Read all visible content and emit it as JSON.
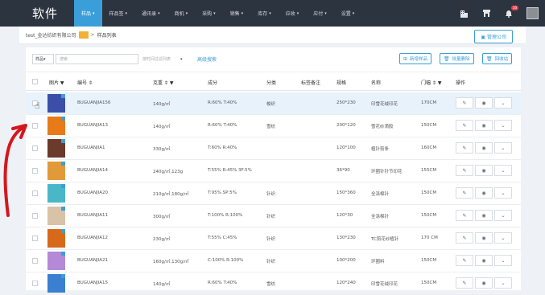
{
  "app": {
    "brand": "软件"
  },
  "nav": [
    {
      "label": "样品",
      "active": true
    },
    {
      "label": "样品签",
      "active": false
    },
    {
      "label": "通讯录",
      "active": false
    },
    {
      "label": "商机",
      "active": false
    },
    {
      "label": "采购",
      "active": false
    },
    {
      "label": "销售",
      "active": false
    },
    {
      "label": "库存",
      "active": false
    },
    {
      "label": "应收",
      "active": false
    },
    {
      "label": "应付",
      "active": false
    },
    {
      "label": "设置",
      "active": false
    }
  ],
  "top": {
    "notify_count": "10"
  },
  "breadcrumb": {
    "company": "test_金达纺织有限公司",
    "sep": ">",
    "page": "样品列表"
  },
  "manage_company": "管理公司",
  "toolbar": {
    "type_select": "样品",
    "search_placeholder": "搜索",
    "filter_placeholder": "按时间过滤列表",
    "advanced": "高级搜索",
    "add": "新增样品",
    "batch_delete": "批量删除",
    "recycle": "回收站"
  },
  "columns": [
    "图片",
    "编号",
    "克重",
    "成分",
    "分类",
    "标签备注",
    "规格",
    "名称",
    "门幅",
    "操作"
  ],
  "rows": [
    {
      "code": "BUGUANJIA156",
      "weight": "140g/㎡",
      "comp": "R:60% T:40%",
      "cat": "梭织",
      "spec": "250*230",
      "name": "印雪花绒印花",
      "width": "170CM",
      "color": "#3b4fa8",
      "hl": true
    },
    {
      "code": "BUGUANJIA13",
      "weight": "140g/㎡",
      "comp": "R:60% T:40%",
      "cat": "雪纺",
      "spec": "200*120",
      "name": "雪花纱滴胶",
      "width": "150CM",
      "color": "#e87a18",
      "hl": false
    },
    {
      "code": "BUGUANJIA1",
      "weight": "330g/㎡",
      "comp": "T:60% R:40%",
      "cat": "",
      "spec": "120*100",
      "name": "植针剪条",
      "width": "160CM",
      "color": "#6b3a2a",
      "hl": false
    },
    {
      "code": "BUGUANJIA14",
      "weight": "240g/㎡,123g",
      "comp": "T:55% R:45% 3F:5%",
      "cat": "",
      "spec": "36*90",
      "name": "环圈针针节印花",
      "width": "155CM",
      "color": "#e09a3a",
      "hl": false
    },
    {
      "code": "BUGUANJIA20",
      "weight": "210g/㎡,180g/㎡",
      "comp": "T:95% SP:5%",
      "cat": "针织",
      "spec": "150*360",
      "name": "全涤棉针",
      "width": "150CM",
      "color": "#4ab7c9",
      "hl": false
    },
    {
      "code": "BUGUANJIA11",
      "weight": "300g/㎡",
      "comp": "T:100% R:100%",
      "cat": "针织",
      "spec": "120*30",
      "name": "全涤棉针",
      "width": "150CM",
      "color": "#d8c3a8",
      "hl": false
    },
    {
      "code": "BUGUANJIA12",
      "weight": "230g/㎡",
      "comp": "T:55% C:45%",
      "cat": "针织",
      "spec": "130*230",
      "name": "TC剪花纱植针",
      "width": "170 CM",
      "color": "#d66a1a",
      "hl": false
    },
    {
      "code": "BUGUANJIA21",
      "weight": "160g/㎡,130g/㎡",
      "comp": "C:100% R:100%",
      "cat": "针织",
      "spec": "100*200",
      "name": "环圈料",
      "width": "150CM",
      "color": "#b48ad8",
      "hl": false
    },
    {
      "code": "BUGUANJIA15",
      "weight": "140g/㎡",
      "comp": "R:60% T:40%",
      "cat": "雪纺",
      "spec": "120*240",
      "name": "印雪花绒印花",
      "width": "150CM",
      "color": "#3a7fd0",
      "hl": false
    }
  ]
}
